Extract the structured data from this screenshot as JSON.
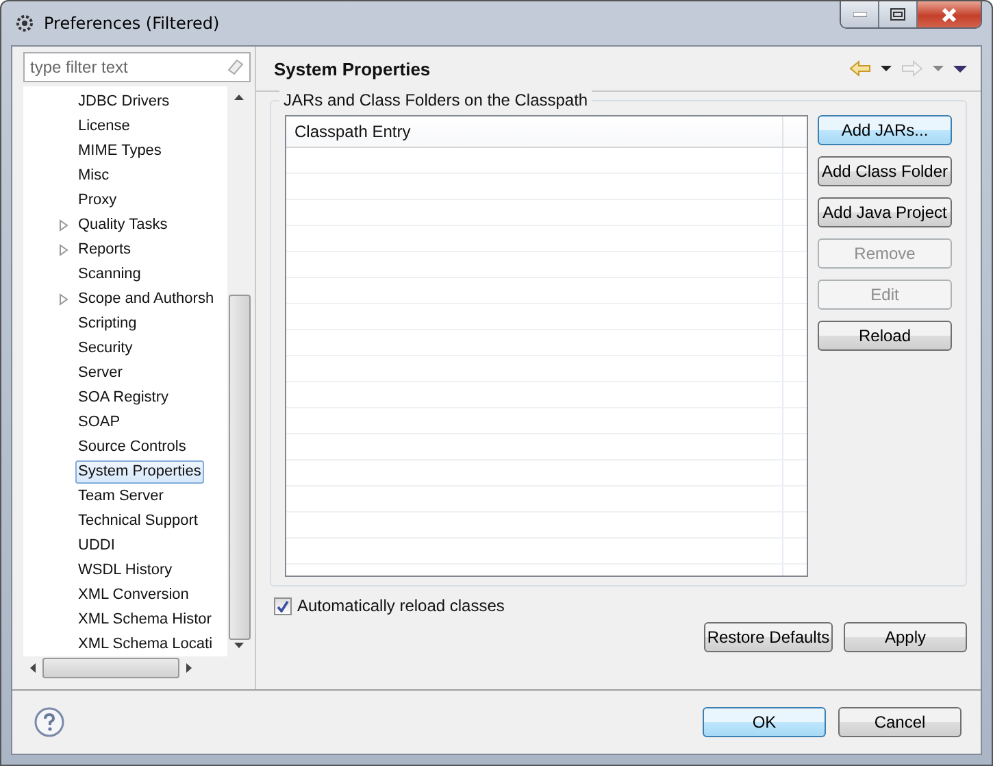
{
  "window": {
    "title": "Preferences (Filtered)"
  },
  "filter": {
    "placeholder": "type filter text"
  },
  "tree": [
    {
      "label": "JDBC Drivers",
      "expandable": false,
      "selected": false
    },
    {
      "label": "License",
      "expandable": false,
      "selected": false
    },
    {
      "label": "MIME Types",
      "expandable": false,
      "selected": false
    },
    {
      "label": "Misc",
      "expandable": false,
      "selected": false
    },
    {
      "label": "Proxy",
      "expandable": false,
      "selected": false
    },
    {
      "label": "Quality Tasks",
      "expandable": true,
      "selected": false
    },
    {
      "label": "Reports",
      "expandable": true,
      "selected": false
    },
    {
      "label": "Scanning",
      "expandable": false,
      "selected": false
    },
    {
      "label": "Scope and Authorsh",
      "expandable": true,
      "selected": false
    },
    {
      "label": "Scripting",
      "expandable": false,
      "selected": false
    },
    {
      "label": "Security",
      "expandable": false,
      "selected": false
    },
    {
      "label": "Server",
      "expandable": false,
      "selected": false
    },
    {
      "label": "SOA Registry",
      "expandable": false,
      "selected": false
    },
    {
      "label": "SOAP",
      "expandable": false,
      "selected": false
    },
    {
      "label": "Source Controls",
      "expandable": false,
      "selected": false
    },
    {
      "label": "System Properties",
      "expandable": false,
      "selected": true
    },
    {
      "label": "Team Server",
      "expandable": false,
      "selected": false
    },
    {
      "label": "Technical Support",
      "expandable": false,
      "selected": false
    },
    {
      "label": "UDDI",
      "expandable": false,
      "selected": false
    },
    {
      "label": "WSDL History",
      "expandable": false,
      "selected": false
    },
    {
      "label": "XML Conversion",
      "expandable": false,
      "selected": false
    },
    {
      "label": "XML Schema Histor",
      "expandable": false,
      "selected": false
    },
    {
      "label": "XML Schema Locati",
      "expandable": false,
      "selected": false
    }
  ],
  "page": {
    "title": "System Properties",
    "group_title": "JARs and Class Folders on the Classpath",
    "table": {
      "columns": [
        "Classpath Entry"
      ]
    },
    "side_buttons": [
      {
        "label": "Add JARs...",
        "disabled": false,
        "default": true
      },
      {
        "label": "Add Class Folder",
        "disabled": false,
        "default": false
      },
      {
        "label": "Add Java Project",
        "disabled": false,
        "default": false
      },
      {
        "label": "Remove",
        "disabled": true,
        "default": false
      },
      {
        "label": "Edit",
        "disabled": true,
        "default": false
      },
      {
        "label": "Reload",
        "disabled": false,
        "default": false
      }
    ],
    "auto_reload": {
      "label": "Automatically reload classes",
      "checked": true
    },
    "page_buttons": [
      {
        "label": "Restore Defaults",
        "default": false
      },
      {
        "label": "Apply",
        "default": false
      }
    ]
  },
  "dialog_buttons": [
    {
      "label": "OK",
      "default": true
    },
    {
      "label": "Cancel",
      "default": false
    }
  ]
}
